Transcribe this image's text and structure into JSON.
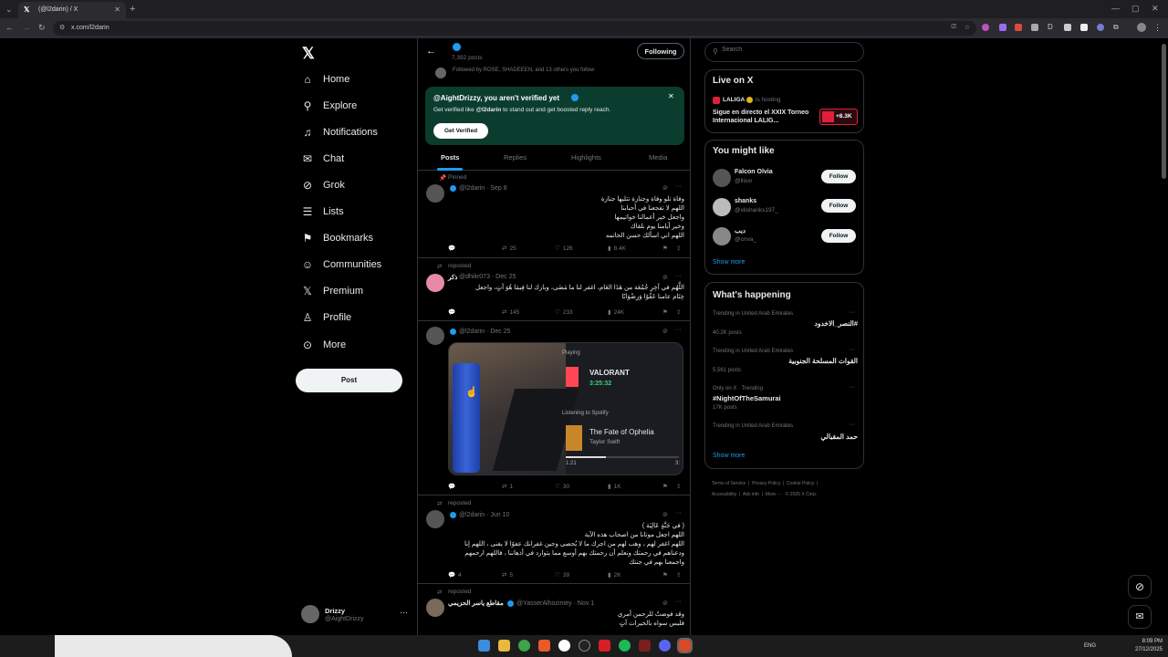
{
  "browser": {
    "tab_title": "(@l2darin) / X",
    "url": "x.com/l2darin"
  },
  "sidebar": {
    "items": [
      {
        "label": "Home"
      },
      {
        "label": "Explore"
      },
      {
        "label": "Notifications"
      },
      {
        "label": "Chat"
      },
      {
        "label": "Grok"
      },
      {
        "label": "Lists"
      },
      {
        "label": "Bookmarks"
      },
      {
        "label": "Communities"
      },
      {
        "label": "Premium"
      },
      {
        "label": "Profile"
      },
      {
        "label": "More"
      }
    ],
    "post_label": "Post",
    "account": {
      "name": "Drizzy",
      "handle": "@AightDrizzy"
    }
  },
  "profile": {
    "posts_count": "7,392 posts",
    "following_label": "Following",
    "followed_by": "Followed by ROSE, SHADEEEN, and 13 others you follow",
    "verify_banner": {
      "title": "@AightDrizzy, you aren't verified yet",
      "body_pre": "Get verified like ",
      "body_handle": "@l2darin",
      "body_post": " to stand out and get boosted reply reach.",
      "button": "Get Verified"
    },
    "tabs": [
      "Posts",
      "Replies",
      "Highlights",
      "Media"
    ]
  },
  "posts": [
    {
      "context": "Pinned",
      "handle_meta": "@l2darin · Sep 8",
      "text": [
        "وفاة تلو وفاة وجنازة تتليها جنازة",
        "اللهم لا تفجعنا في أحبابنا",
        "واجعل خير أعمالنا خواتيمها",
        "وخير أيامنا يوم نلقاك",
        "اللهم اني اسألك حسن الخاتمه"
      ],
      "stats": {
        "retweets": "25",
        "likes": "126",
        "views": "8.4K"
      }
    },
    {
      "context": "reposted",
      "name": "ذكر",
      "handle_meta": "@dhikr073 · Dec 25",
      "text": [
        "اللَّهُم في آخِرِ جُمُعَة من هَذَا العَام، اغفر لنا ما مَضَى، وبارك لنا فِيمَا هُوَ آتٍ، واجعل",
        "خِتَام عامنا عَفْوًا وَرِضْوَانًا"
      ],
      "stats": {
        "retweets": "145",
        "likes": "233",
        "views": "24K"
      }
    },
    {
      "context": "",
      "handle_meta": "@l2darin · Dec 25",
      "media": {
        "game_status": "Playing",
        "game": "VALORANT",
        "game_time": "3:25:32",
        "spotify_label": "Listening to Spotify",
        "song": "The Fate of Ophelia",
        "artist": "Taylor Swift",
        "song_time": "1:21",
        "song_end": "3:"
      },
      "stats": {
        "replies": "",
        "retweets": "1",
        "likes": "30",
        "views": "1K"
      }
    },
    {
      "context": "reposted",
      "handle_meta": "@l2darin · Jun 10",
      "text": [
        "( في جَنَّةٍ عَالِيَة )",
        "اللهم اجعل موتانا من اصحاب هذه الآية",
        "اللهم اغفر لهم ، وهب لهم من اجرك ما لا يُحصى وجين غفرانك عفوًا لا يفنى ، اللهم إنا",
        "ودعناهم في رحمتك ونعلم أن رحمتك بهم أوسع مما يتوارد في أذهاننا ، فاللهم ارحمهم",
        "واجمعنا بهم في جنتك"
      ],
      "stats": {
        "replies": "4",
        "retweets": "5",
        "likes": "39",
        "views": "2K"
      }
    },
    {
      "context": "reposted",
      "name": "مقاطع ياسر الحزيمي",
      "handle_meta": "@YasserAlhozimey · Nov 1",
      "text": [
        "وقد فوضتُ للرحمن أمري",
        "فليس سواه بالخيرات آتٍ"
      ]
    }
  ],
  "right": {
    "search_placeholder": "Search",
    "live": {
      "title": "Live on X",
      "host": "LALIGA",
      "hosting": "is hosting",
      "text": "Sigue en directo el XXIX Torneo Internacional LALIG...",
      "count": "+8.3K"
    },
    "might_like": {
      "title": "You might like",
      "users": [
        {
          "name": "Falcon Olvia",
          "handle": "@llixxr",
          "button": "Follow"
        },
        {
          "name": "shanks",
          "handle": "@xlishanks197_",
          "button": "Follow"
        },
        {
          "name": "ديب",
          "handle": "@cnva_",
          "button": "Follow"
        }
      ],
      "show_more": "Show more"
    },
    "happening": {
      "title": "What's happening",
      "trends": [
        {
          "context": "Trending in United Arab Emirates",
          "topic": "#النصر_الاخدود",
          "count": "40.2K posts"
        },
        {
          "context": "Trending in United Arab Emirates",
          "topic": "القوات المسلحة الجنوبية",
          "count": "5,561 posts"
        },
        {
          "context": "Only on X · Trending",
          "topic": "#NightOfTheSamurai",
          "count": "17K posts"
        },
        {
          "context": "Trending in United Arab Emirates",
          "topic": "حمد المقبالي",
          "count": ""
        }
      ],
      "show_more": "Show more"
    },
    "footer": [
      "Terms of Service",
      "Privacy Policy",
      "Cookie Policy",
      "Accessibility",
      "Ads info",
      "More ···",
      "© 2025 X Corp."
    ]
  },
  "taskbar": {
    "lang": "ENG",
    "time": "8:09 PM",
    "date": "27/12/2025"
  }
}
